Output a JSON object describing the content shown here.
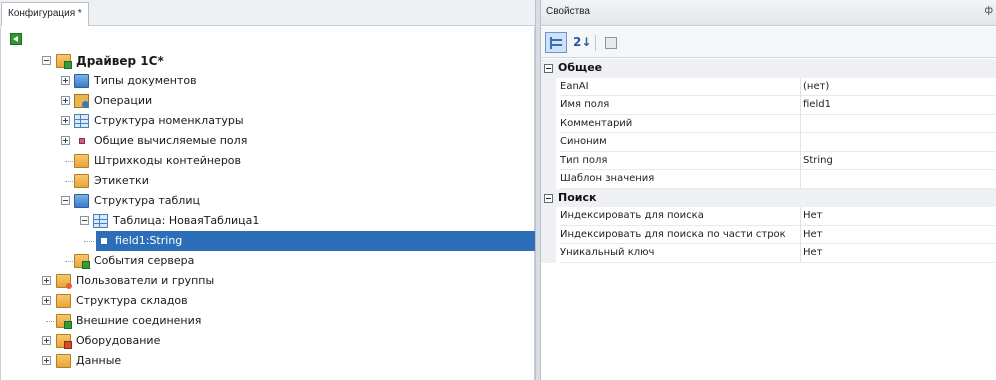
{
  "left_tab": {
    "label": "Конфигурация *"
  },
  "tree": {
    "items": [
      {
        "label": "Драйвер 1C*"
      },
      {
        "label": "Типы документов"
      },
      {
        "label": "Операции"
      },
      {
        "label": "Структура номенклатуры"
      },
      {
        "label": "Общие вычисляемые поля"
      },
      {
        "label": "Штрихкоды контейнеров"
      },
      {
        "label": "Этикетки"
      },
      {
        "label": "Структура таблиц"
      },
      {
        "label": "Таблица: НоваяТаблица1"
      },
      {
        "label": "field1:String"
      },
      {
        "label": "События сервера"
      },
      {
        "label": "Пользователи и группы"
      },
      {
        "label": "Структура складов"
      },
      {
        "label": "Внешние соединения"
      },
      {
        "label": "Оборудование"
      },
      {
        "label": "Данные"
      }
    ]
  },
  "properties": {
    "title": "Свойства",
    "pin_glyph": "ф",
    "toolbar": {
      "categorized_glyph": "",
      "alpha_glyph": "2↓",
      "pages_glyph": ""
    },
    "categories": [
      {
        "name": "Общее",
        "rows": [
          {
            "name": "EanAI",
            "value": "(нет)"
          },
          {
            "name": "Имя поля",
            "value": "field1"
          },
          {
            "name": "Комментарий",
            "value": ""
          },
          {
            "name": "Синоним",
            "value": ""
          },
          {
            "name": "Тип поля",
            "value": "String"
          },
          {
            "name": "Шаблон значения",
            "value": ""
          }
        ]
      },
      {
        "name": "Поиск",
        "rows": [
          {
            "name": "Индексировать для поиска",
            "value": "Нет"
          },
          {
            "name": "Индексировать для поиска по части строк",
            "value": "Нет"
          },
          {
            "name": "Уникальный ключ",
            "value": "Нет"
          }
        ]
      }
    ]
  },
  "colors": {
    "selection": "#2c6fb8",
    "folder": "#e7a53b",
    "accent_green": "#2e9a2e"
  }
}
